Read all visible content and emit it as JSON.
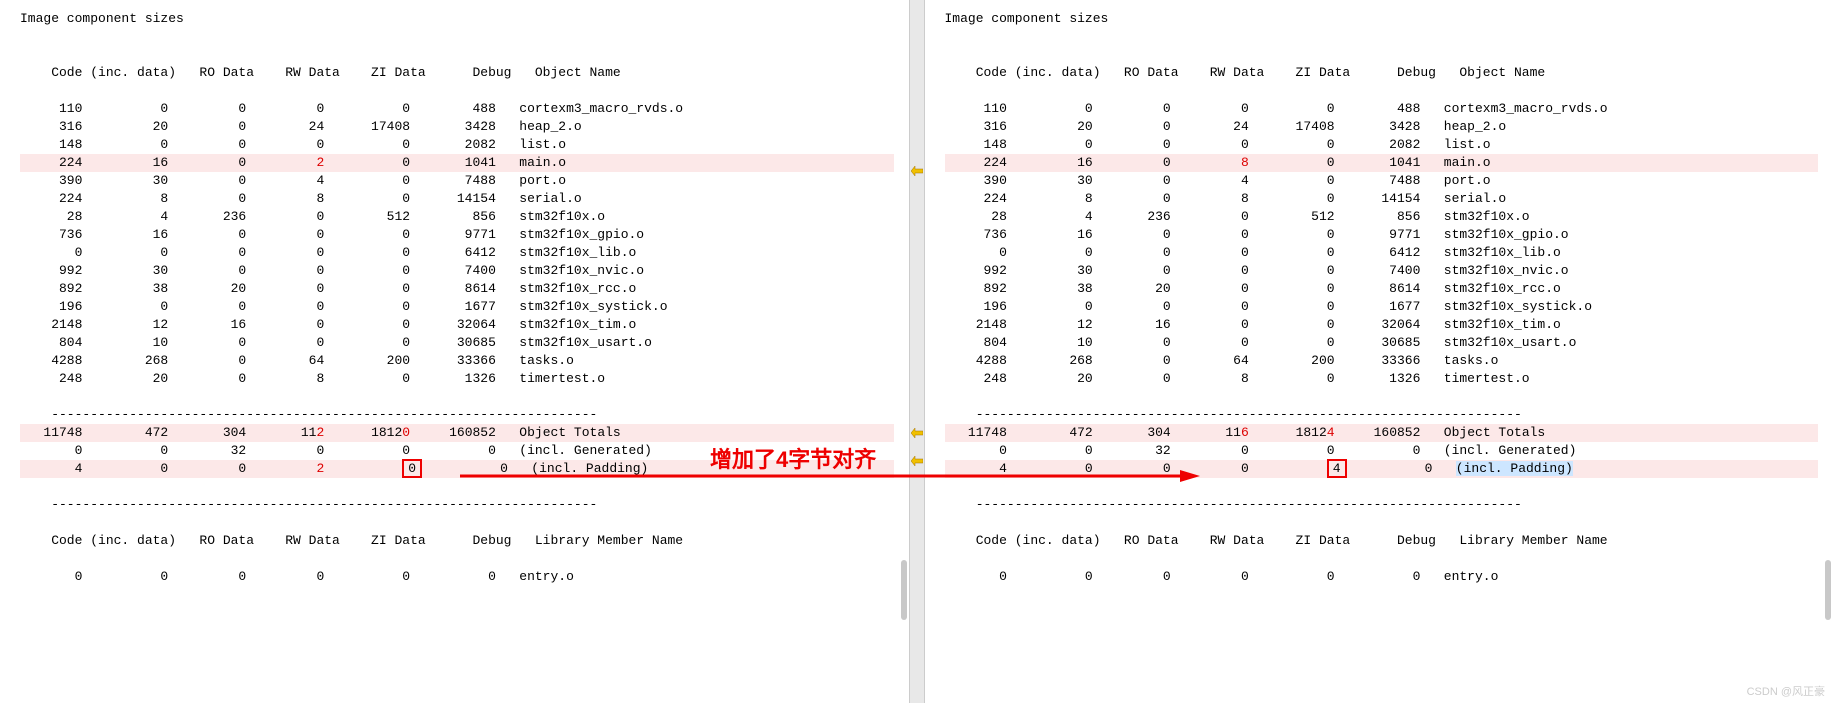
{
  "title": "Image component sizes",
  "headers": [
    "Code (inc. data)",
    "RO Data",
    "RW Data",
    "ZI Data",
    "Debug",
    "Object Name"
  ],
  "libheaders": [
    "Code (inc. data)",
    "RO Data",
    "RW Data",
    "ZI Data",
    "Debug",
    "Library Member Name"
  ],
  "left": {
    "rows": [
      {
        "c": "110",
        "i": "0",
        "ro": "0",
        "rw": "0",
        "zi": "0",
        "dbg": "488",
        "name": "cortexm3_macro_rvds.o"
      },
      {
        "c": "316",
        "i": "20",
        "ro": "0",
        "rw": "24",
        "zi": "17408",
        "dbg": "3428",
        "name": "heap_2.o"
      },
      {
        "c": "148",
        "i": "0",
        "ro": "0",
        "rw": "0",
        "zi": "0",
        "dbg": "2082",
        "name": "list.o"
      },
      {
        "c": "224",
        "i": "16",
        "ro": "0",
        "rw": "2",
        "zi": "0",
        "dbg": "1041",
        "name": "main.o",
        "hl": true,
        "rw_diff": true
      },
      {
        "c": "390",
        "i": "30",
        "ro": "0",
        "rw": "4",
        "zi": "0",
        "dbg": "7488",
        "name": "port.o"
      },
      {
        "c": "224",
        "i": "8",
        "ro": "0",
        "rw": "8",
        "zi": "0",
        "dbg": "14154",
        "name": "serial.o"
      },
      {
        "c": "28",
        "i": "4",
        "ro": "236",
        "rw": "0",
        "zi": "512",
        "dbg": "856",
        "name": "stm32f10x.o"
      },
      {
        "c": "736",
        "i": "16",
        "ro": "0",
        "rw": "0",
        "zi": "0",
        "dbg": "9771",
        "name": "stm32f10x_gpio.o"
      },
      {
        "c": "0",
        "i": "0",
        "ro": "0",
        "rw": "0",
        "zi": "0",
        "dbg": "6412",
        "name": "stm32f10x_lib.o"
      },
      {
        "c": "992",
        "i": "30",
        "ro": "0",
        "rw": "0",
        "zi": "0",
        "dbg": "7400",
        "name": "stm32f10x_nvic.o"
      },
      {
        "c": "892",
        "i": "38",
        "ro": "20",
        "rw": "0",
        "zi": "0",
        "dbg": "8614",
        "name": "stm32f10x_rcc.o"
      },
      {
        "c": "196",
        "i": "0",
        "ro": "0",
        "rw": "0",
        "zi": "0",
        "dbg": "1677",
        "name": "stm32f10x_systick.o"
      },
      {
        "c": "2148",
        "i": "12",
        "ro": "16",
        "rw": "0",
        "zi": "0",
        "dbg": "32064",
        "name": "stm32f10x_tim.o"
      },
      {
        "c": "804",
        "i": "10",
        "ro": "0",
        "rw": "0",
        "zi": "0",
        "dbg": "30685",
        "name": "stm32f10x_usart.o"
      },
      {
        "c": "4288",
        "i": "268",
        "ro": "0",
        "rw": "64",
        "zi": "200",
        "dbg": "33366",
        "name": "tasks.o"
      },
      {
        "c": "248",
        "i": "20",
        "ro": "0",
        "rw": "8",
        "zi": "0",
        "dbg": "1326",
        "name": "timertest.o"
      }
    ],
    "totals": [
      {
        "c": "11748",
        "i": "472",
        "ro": "304",
        "rw": "112",
        "zi": "18120",
        "dbg": "160852",
        "name": "Object Totals",
        "hl": true,
        "rw_diff": true,
        "zi_diff": true
      },
      {
        "c": "0",
        "i": "0",
        "ro": "32",
        "rw": "0",
        "zi": "0",
        "dbg": "0",
        "name": "(incl. Generated)"
      },
      {
        "c": "4",
        "i": "0",
        "ro": "0",
        "rw": "2",
        "zi": "0",
        "dbg": "0",
        "name": "(incl. Padding)",
        "hl": true,
        "rw_diff": true,
        "zi_box": "0"
      }
    ],
    "librow": {
      "c": "0",
      "i": "0",
      "ro": "0",
      "rw": "0",
      "zi": "0",
      "dbg": "0",
      "name": "entry.o"
    }
  },
  "right": {
    "rows": [
      {
        "c": "110",
        "i": "0",
        "ro": "0",
        "rw": "0",
        "zi": "0",
        "dbg": "488",
        "name": "cortexm3_macro_rvds.o"
      },
      {
        "c": "316",
        "i": "20",
        "ro": "0",
        "rw": "24",
        "zi": "17408",
        "dbg": "3428",
        "name": "heap_2.o"
      },
      {
        "c": "148",
        "i": "0",
        "ro": "0",
        "rw": "0",
        "zi": "0",
        "dbg": "2082",
        "name": "list.o"
      },
      {
        "c": "224",
        "i": "16",
        "ro": "0",
        "rw": "8",
        "zi": "0",
        "dbg": "1041",
        "name": "main.o",
        "hl": true,
        "rw_diff": true
      },
      {
        "c": "390",
        "i": "30",
        "ro": "0",
        "rw": "4",
        "zi": "0",
        "dbg": "7488",
        "name": "port.o"
      },
      {
        "c": "224",
        "i": "8",
        "ro": "0",
        "rw": "8",
        "zi": "0",
        "dbg": "14154",
        "name": "serial.o"
      },
      {
        "c": "28",
        "i": "4",
        "ro": "236",
        "rw": "0",
        "zi": "512",
        "dbg": "856",
        "name": "stm32f10x.o"
      },
      {
        "c": "736",
        "i": "16",
        "ro": "0",
        "rw": "0",
        "zi": "0",
        "dbg": "9771",
        "name": "stm32f10x_gpio.o"
      },
      {
        "c": "0",
        "i": "0",
        "ro": "0",
        "rw": "0",
        "zi": "0",
        "dbg": "6412",
        "name": "stm32f10x_lib.o"
      },
      {
        "c": "992",
        "i": "30",
        "ro": "0",
        "rw": "0",
        "zi": "0",
        "dbg": "7400",
        "name": "stm32f10x_nvic.o"
      },
      {
        "c": "892",
        "i": "38",
        "ro": "20",
        "rw": "0",
        "zi": "0",
        "dbg": "8614",
        "name": "stm32f10x_rcc.o"
      },
      {
        "c": "196",
        "i": "0",
        "ro": "0",
        "rw": "0",
        "zi": "0",
        "dbg": "1677",
        "name": "stm32f10x_systick.o"
      },
      {
        "c": "2148",
        "i": "12",
        "ro": "16",
        "rw": "0",
        "zi": "0",
        "dbg": "32064",
        "name": "stm32f10x_tim.o"
      },
      {
        "c": "804",
        "i": "10",
        "ro": "0",
        "rw": "0",
        "zi": "0",
        "dbg": "30685",
        "name": "stm32f10x_usart.o"
      },
      {
        "c": "4288",
        "i": "268",
        "ro": "0",
        "rw": "64",
        "zi": "200",
        "dbg": "33366",
        "name": "tasks.o"
      },
      {
        "c": "248",
        "i": "20",
        "ro": "0",
        "rw": "8",
        "zi": "0",
        "dbg": "1326",
        "name": "timertest.o"
      }
    ],
    "totals": [
      {
        "c": "11748",
        "i": "472",
        "ro": "304",
        "rw": "116",
        "zi": "18124",
        "dbg": "160852",
        "name": "Object Totals",
        "hl": true,
        "rw_diff": true,
        "zi_diff": true
      },
      {
        "c": "0",
        "i": "0",
        "ro": "32",
        "rw": "0",
        "zi": "0",
        "dbg": "0",
        "name": "(incl. Generated)"
      },
      {
        "c": "4",
        "i": "0",
        "ro": "0",
        "rw": "0",
        "zi": "4",
        "dbg": "0",
        "name": "(incl. Padding)",
        "hl": true,
        "zi_box": "4",
        "name_sel": true
      }
    ],
    "librow": {
      "c": "0",
      "i": "0",
      "ro": "0",
      "rw": "0",
      "zi": "0",
      "dbg": "0",
      "name": "entry.o"
    }
  },
  "annotation": "增加了4字节对齐",
  "watermark": "CSDN @风正豪",
  "dashes": "----------------------------------------------------------------------"
}
